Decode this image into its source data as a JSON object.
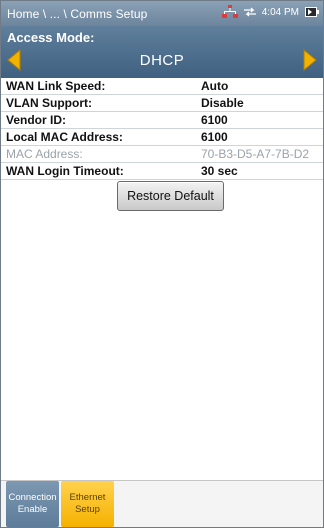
{
  "status_bar": {
    "breadcrumb": "Home \\ ... \\ Comms Setup",
    "time": "4:04 PM",
    "icons": [
      "network-icon",
      "link-arrows-icon",
      "battery-icon"
    ]
  },
  "access_mode": {
    "label": "Access Mode:",
    "value": "DHCP"
  },
  "settings": [
    {
      "label": "WAN Link Speed:",
      "value": "Auto",
      "enabled": true
    },
    {
      "label": "VLAN Support:",
      "value": "Disable",
      "enabled": true
    },
    {
      "label": "Vendor ID:",
      "value": "6100",
      "enabled": true
    },
    {
      "label": "Local MAC Address:",
      "value": "6100",
      "enabled": true
    },
    {
      "label": "MAC Address:",
      "value": "70-B3-D5-A7-7B-D2",
      "enabled": false
    },
    {
      "label": "WAN Login Timeout:",
      "value": "30 sec",
      "enabled": true
    }
  ],
  "restore_button": "Restore Default",
  "softkeys": {
    "connection_line1": "Connection",
    "connection_line2": "Enable",
    "ethernet_line1": "Ethernet",
    "ethernet_line2": "Setup"
  },
  "colors": {
    "status_bar": "#7a93aa",
    "header": "#4f7090",
    "arrow": "#f2b200",
    "selected_softkey": "#f5b100"
  }
}
